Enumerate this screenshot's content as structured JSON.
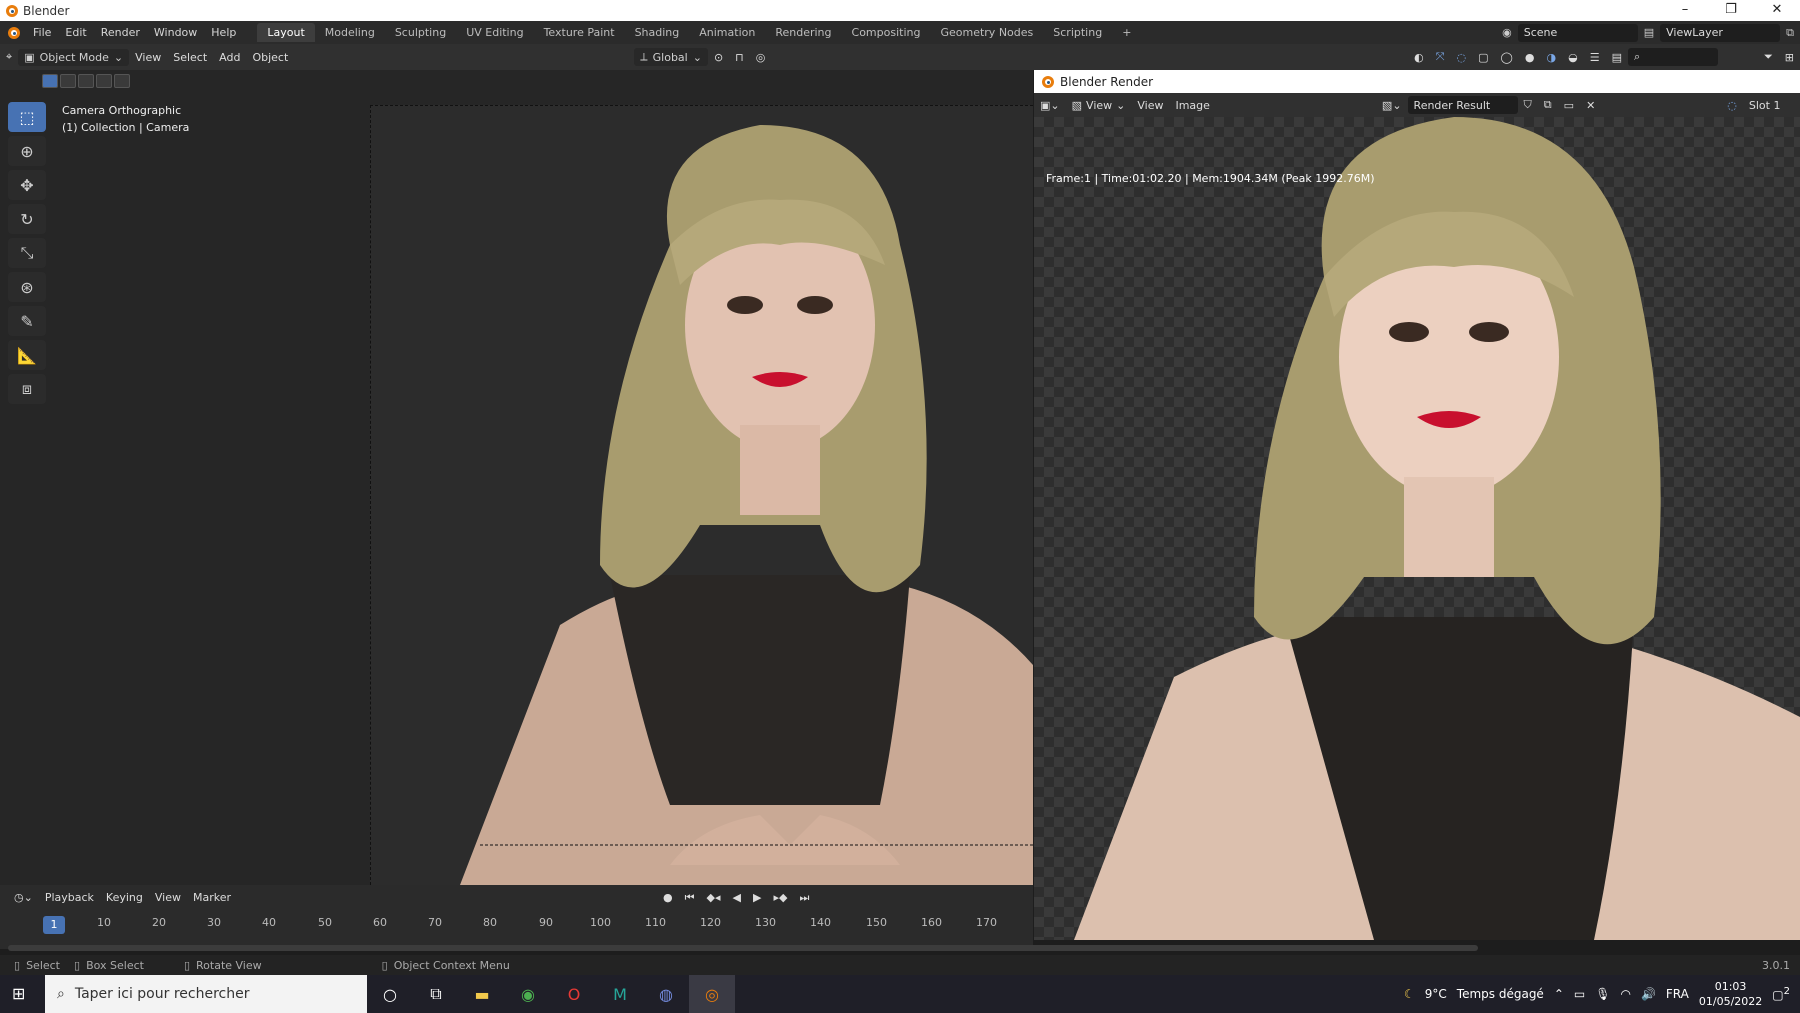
{
  "window": {
    "title": "Blender",
    "min": "–",
    "max": "❐",
    "close": "✕"
  },
  "topbar": {
    "menu": [
      "File",
      "Edit",
      "Render",
      "Window",
      "Help"
    ],
    "tabs": [
      "Layout",
      "Modeling",
      "Sculpting",
      "UV Editing",
      "Texture Paint",
      "Shading",
      "Animation",
      "Rendering",
      "Compositing",
      "Geometry Nodes",
      "Scripting"
    ],
    "add_tab": "+",
    "scene": "Scene",
    "view_layer": "ViewLayer"
  },
  "viewport_header": {
    "mode": "Object Mode",
    "menus": [
      "View",
      "Select",
      "Add",
      "Object"
    ],
    "orientation": "Global"
  },
  "viewport": {
    "info_line1": "Camera Orthographic",
    "info_line2": "(1) Collection | Camera"
  },
  "render_window": {
    "title": "Blender Render",
    "menus": [
      "View",
      "View",
      "Image"
    ],
    "result": "Render Result",
    "slot": "Slot 1",
    "info": "Frame:1 | Time:01:02.20 | Mem:1904.34M (Peak 1992.76M)"
  },
  "timeline": {
    "menus": [
      "Playback",
      "Keying",
      "View",
      "Marker"
    ],
    "current_frame": "1",
    "ticks": [
      "10",
      "20",
      "30",
      "40",
      "50",
      "60",
      "70",
      "80",
      "90",
      "100",
      "110",
      "120",
      "130",
      "140",
      "150",
      "160",
      "170"
    ]
  },
  "statusbar": {
    "select": "Select",
    "box_select": "Box Select",
    "rotate_view": "Rotate View",
    "context_menu": "Object Context Menu",
    "version": "3.0.1"
  },
  "taskbar": {
    "search_placeholder": "Taper ici pour rechercher",
    "weather_temp": "9°C",
    "weather_text": "Temps dégagé",
    "language": "FRA",
    "time": "01:03",
    "date": "01/05/2022",
    "notif_count": "2"
  },
  "colors": {
    "accent": "#4772b3",
    "blender_orange": "#e87d0d",
    "lip": "#c8102e",
    "hair": "#a89c6e"
  }
}
